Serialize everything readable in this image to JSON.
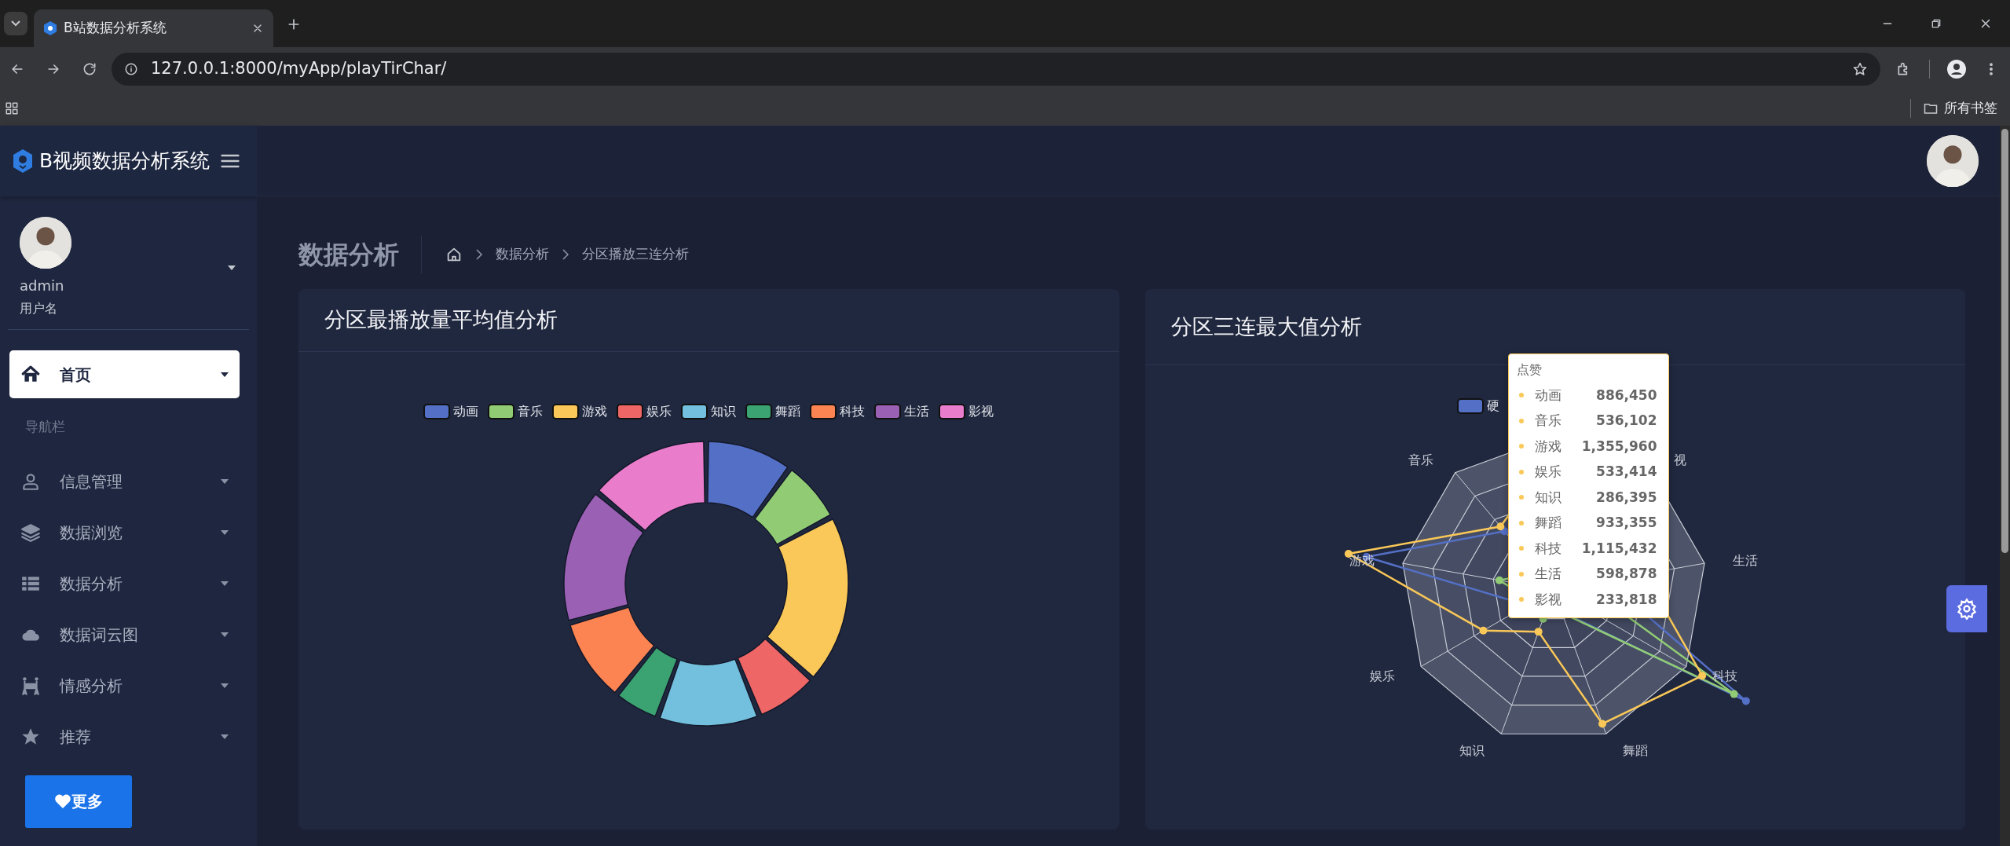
{
  "browser": {
    "tab_title": "B站数据分析系统",
    "url": "127.0.0.1:8000/myApp/playTirChar/",
    "bookmarks_label": "所有书签"
  },
  "sidebar": {
    "brand": "B视频数据分析系统",
    "user": {
      "name": "admin",
      "role": "用户名"
    },
    "section_label": "导航栏",
    "items": [
      {
        "label": "首页",
        "selected": true
      },
      {
        "label": "信息管理",
        "selected": false
      },
      {
        "label": "数据浏览",
        "selected": false
      },
      {
        "label": "数据分析",
        "selected": false
      },
      {
        "label": "数据词云图",
        "selected": false
      },
      {
        "label": "情感分析",
        "selected": false
      },
      {
        "label": "推荐",
        "selected": false
      }
    ],
    "more_button": "更多"
  },
  "page": {
    "title": "数据分析",
    "breadcrumb": [
      "数据分析",
      "分区播放三连分析"
    ]
  },
  "cards": [
    {
      "title": "分区最播放量平均值分析",
      "legend": [
        {
          "label": "动画",
          "color": "#5470c6"
        },
        {
          "label": "音乐",
          "color": "#91cc75"
        },
        {
          "label": "游戏",
          "color": "#fac858"
        },
        {
          "label": "娱乐",
          "color": "#ee6666"
        },
        {
          "label": "知识",
          "color": "#73c0de"
        },
        {
          "label": "舞蹈",
          "color": "#3ba272"
        },
        {
          "label": "科技",
          "color": "#fc8452"
        },
        {
          "label": "生活",
          "color": "#9a60b4"
        },
        {
          "label": "影视",
          "color": "#ea7ccc"
        }
      ]
    },
    {
      "title": "分区三连最大值分析",
      "legend": [
        {
          "label": "硬",
          "color": "#5470c6"
        }
      ],
      "axes": [
        "音乐",
        "游戏",
        "娱乐",
        "知识",
        "舞蹈",
        "科技",
        "生活",
        "视"
      ],
      "tooltip": {
        "title": "点赞",
        "rows": [
          {
            "label": "动画",
            "value": "886,450"
          },
          {
            "label": "音乐",
            "value": "536,102"
          },
          {
            "label": "游戏",
            "value": "1,355,960"
          },
          {
            "label": "娱乐",
            "value": "533,414"
          },
          {
            "label": "知识",
            "value": "286,395"
          },
          {
            "label": "舞蹈",
            "value": "933,355"
          },
          {
            "label": "科技",
            "value": "1,115,432"
          },
          {
            "label": "生活",
            "value": "598,878"
          },
          {
            "label": "影视",
            "value": "233,818"
          }
        ]
      }
    }
  ]
}
